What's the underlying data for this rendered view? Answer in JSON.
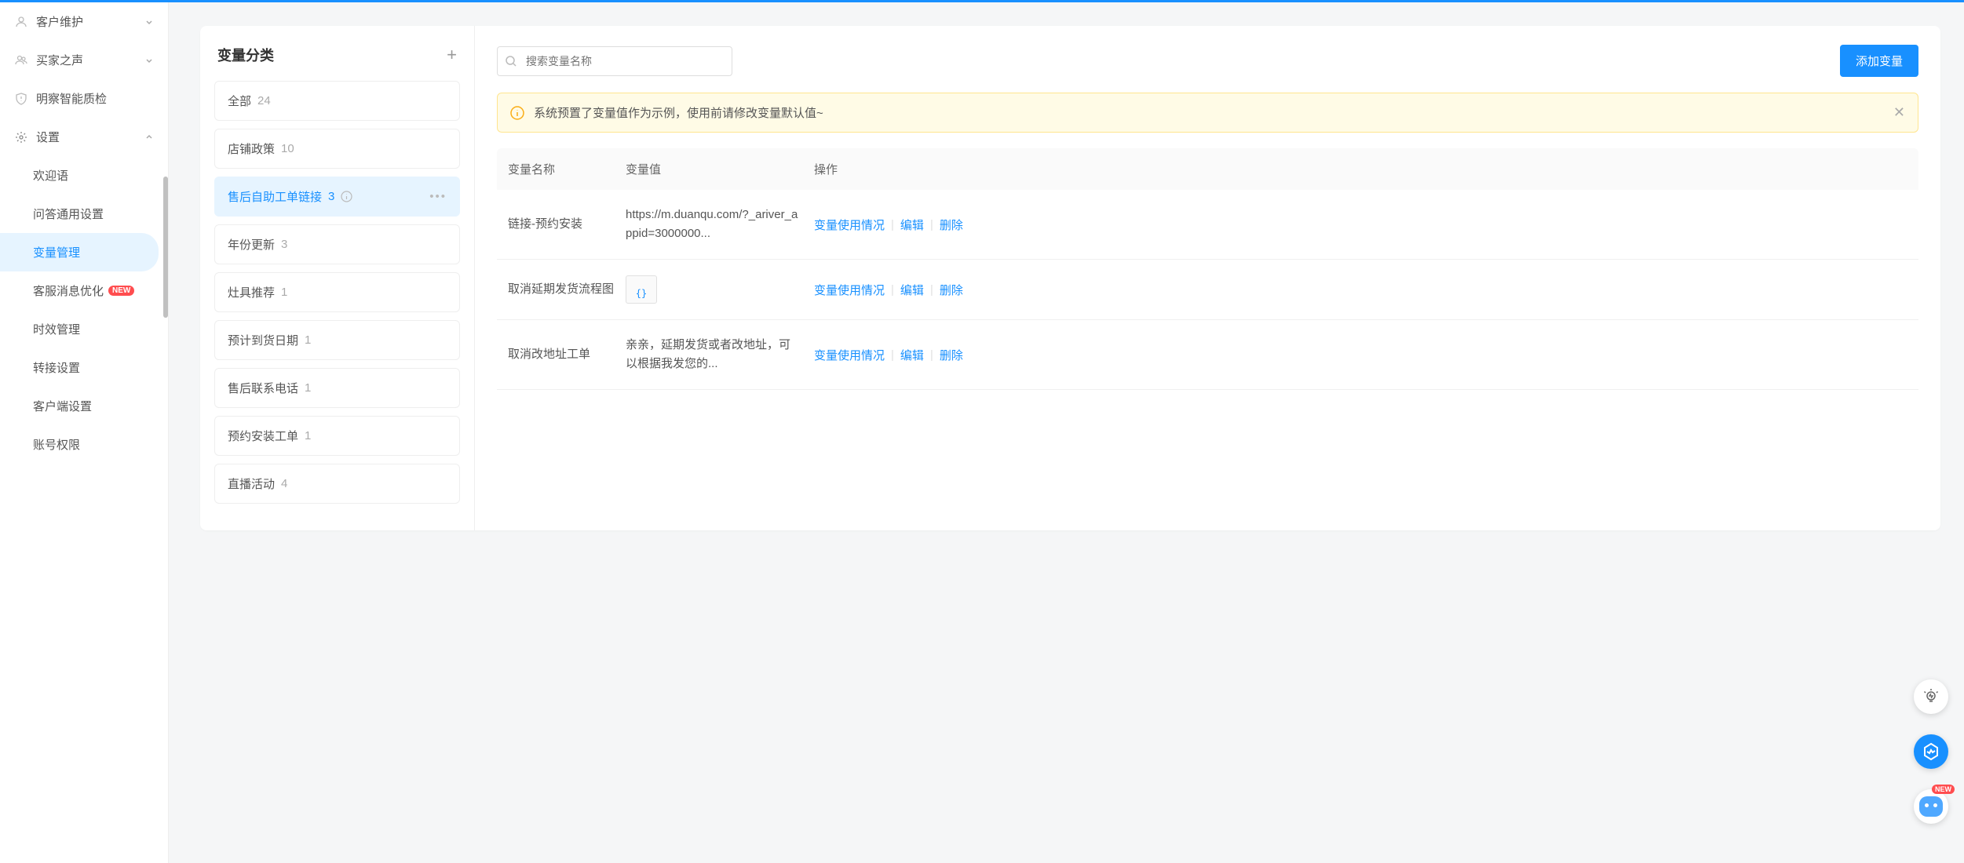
{
  "sidebar": {
    "nav": [
      {
        "label": "客户维护",
        "icon": "user"
      },
      {
        "label": "买家之声",
        "icon": "group"
      },
      {
        "label": "明察智能质检",
        "icon": "shield"
      },
      {
        "label": "设置",
        "icon": "gear",
        "expanded": true
      }
    ],
    "sub": [
      {
        "label": "欢迎语"
      },
      {
        "label": "问答通用设置"
      },
      {
        "label": "变量管理",
        "active": true
      },
      {
        "label": "客服消息优化",
        "badge": "NEW"
      },
      {
        "label": "时效管理"
      },
      {
        "label": "转接设置"
      },
      {
        "label": "客户端设置"
      },
      {
        "label": "账号权限"
      }
    ]
  },
  "category": {
    "title": "变量分类",
    "items": [
      {
        "name": "全部",
        "count": "24"
      },
      {
        "name": "店铺政策",
        "count": "10"
      },
      {
        "name": "售后自助工单链接",
        "count": "3",
        "selected": true,
        "info": true,
        "more": true
      },
      {
        "name": "年份更新",
        "count": "3"
      },
      {
        "name": "灶具推荐",
        "count": "1"
      },
      {
        "name": "预计到货日期",
        "count": "1"
      },
      {
        "name": "售后联系电话",
        "count": "1"
      },
      {
        "name": "预约安装工单",
        "count": "1"
      },
      {
        "name": "直播活动",
        "count": "4"
      }
    ]
  },
  "content": {
    "search_placeholder": "搜索变量名称",
    "add_btn": "添加变量",
    "alert": "系统预置了变量值作为示例，使用前请修改变量默认值~",
    "headers": {
      "name": "变量名称",
      "value": "变量值",
      "actions": "操作"
    },
    "action_labels": {
      "usage": "变量使用情况",
      "edit": "编辑",
      "delete": "删除"
    },
    "rows": [
      {
        "name": "链接-预约安装",
        "value": "https://m.duanqu.com/?_ariver_appid=3000000..."
      },
      {
        "name": "取消延期发货流程图",
        "value_is_image": true
      },
      {
        "name": "取消改地址工单",
        "value": "亲亲，延期发货或者改地址，可以根据我发您的..."
      }
    ]
  },
  "float": {
    "new": "NEW"
  }
}
